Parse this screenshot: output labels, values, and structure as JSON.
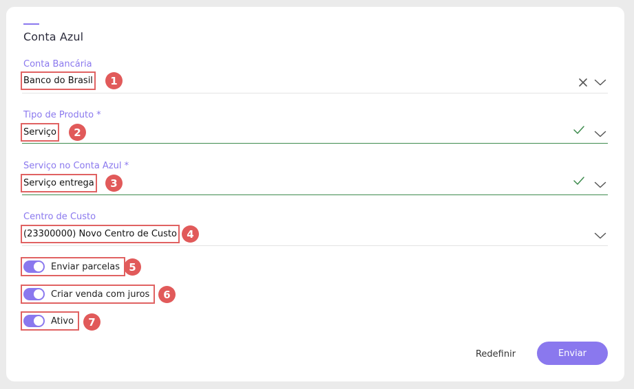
{
  "title": "Conta Azul",
  "colors": {
    "accent": "#8a78ee",
    "annotation": "#e15a5a",
    "valid": "#3c8a4c"
  },
  "fields": [
    {
      "label": "Conta Bancária",
      "value": "Banco do Brasil",
      "badge": "1",
      "icons": [
        "close-icon",
        "chevron-down-icon"
      ]
    },
    {
      "label": "Tipo de Produto *",
      "value": "Serviço",
      "badge": "2",
      "icons": [
        "check-icon",
        "chevron-down-icon"
      ]
    },
    {
      "label": "Serviço no Conta Azul *",
      "value": "Serviço entrega",
      "badge": "3",
      "icons": [
        "check-icon",
        "chevron-down-icon"
      ]
    },
    {
      "label": "Centro de Custo",
      "value": "(23300000) Novo Centro de Custo",
      "badge": "4",
      "icons": [
        "chevron-down-icon"
      ]
    }
  ],
  "toggles": [
    {
      "label": "Enviar parcelas",
      "badge": "5",
      "checked": true
    },
    {
      "label": "Criar venda com juros",
      "badge": "6",
      "checked": true
    },
    {
      "label": "Ativo",
      "badge": "7",
      "checked": true
    }
  ],
  "actions": {
    "reset_label": "Redefinir",
    "submit_label": "Enviar"
  }
}
